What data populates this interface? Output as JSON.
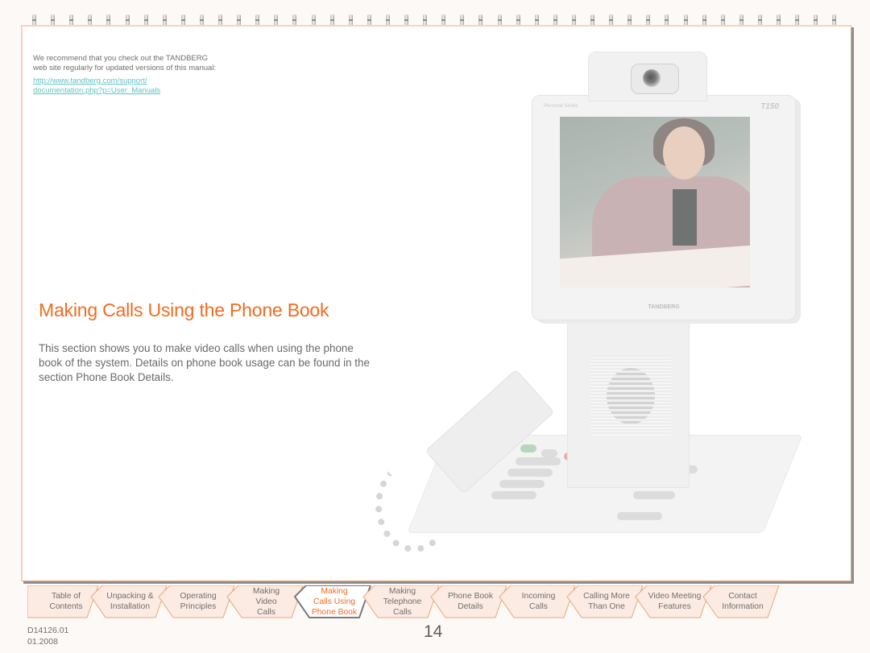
{
  "note": {
    "text": "We recommend that you check out the TANDBERG web site regularly for updated versions of this manual:",
    "link_line1": "http://www.tandberg.com/support/",
    "link_line2": "documentation.php?p=User_Manuals"
  },
  "section": {
    "title": "Making Calls Using the Phone Book",
    "intro": "This section shows you to make video calls when using the phone book of the system. Details on phone book usage can be found in the section Phone Book Details."
  },
  "device": {
    "model_label": "T150",
    "brand_label": "TANDBERG",
    "small_label": "Personal Series",
    "image_description": "TANDBERG T150 video phone with handset, showing a woman on screen"
  },
  "tabs": [
    {
      "label": "Table of Contents",
      "lines": [
        "Table of",
        "Contents"
      ],
      "active": false
    },
    {
      "label": "Unpacking & Installation",
      "lines": [
        "Unpacking &",
        "Installation"
      ],
      "active": false
    },
    {
      "label": "Operating Principles",
      "lines": [
        "Operating",
        "Principles"
      ],
      "active": false
    },
    {
      "label": "Making Video Calls",
      "lines": [
        "Making",
        "Video",
        "Calls"
      ],
      "active": false
    },
    {
      "label": "Making Calls Using Phone Book",
      "lines": [
        "Making",
        "Calls Using",
        "Phone Book"
      ],
      "active": true
    },
    {
      "label": "Making Telephone Calls",
      "lines": [
        "Making",
        "Telephone",
        "Calls"
      ],
      "active": false
    },
    {
      "label": "Phone Book Details",
      "lines": [
        "Phone Book",
        "Details"
      ],
      "active": false
    },
    {
      "label": "Incoming Calls",
      "lines": [
        "Incoming",
        "Calls"
      ],
      "active": false
    },
    {
      "label": "Calling More Than One",
      "lines": [
        "Calling More",
        "Than One"
      ],
      "active": false
    },
    {
      "label": "Video Meeting Features",
      "lines": [
        "Video Meeting",
        "Features"
      ],
      "active": false
    },
    {
      "label": "Contact Information",
      "lines": [
        "Contact",
        "Information"
      ],
      "active": false
    }
  ],
  "footer": {
    "doc_number": "D14126.01",
    "doc_date": "01.2008",
    "page_number": "14"
  },
  "colors": {
    "accent": "#f26b21",
    "link": "#62c2c7",
    "tab_fill": "#fcebe3",
    "tab_border": "#e8a778",
    "text": "#6f6f6f"
  }
}
